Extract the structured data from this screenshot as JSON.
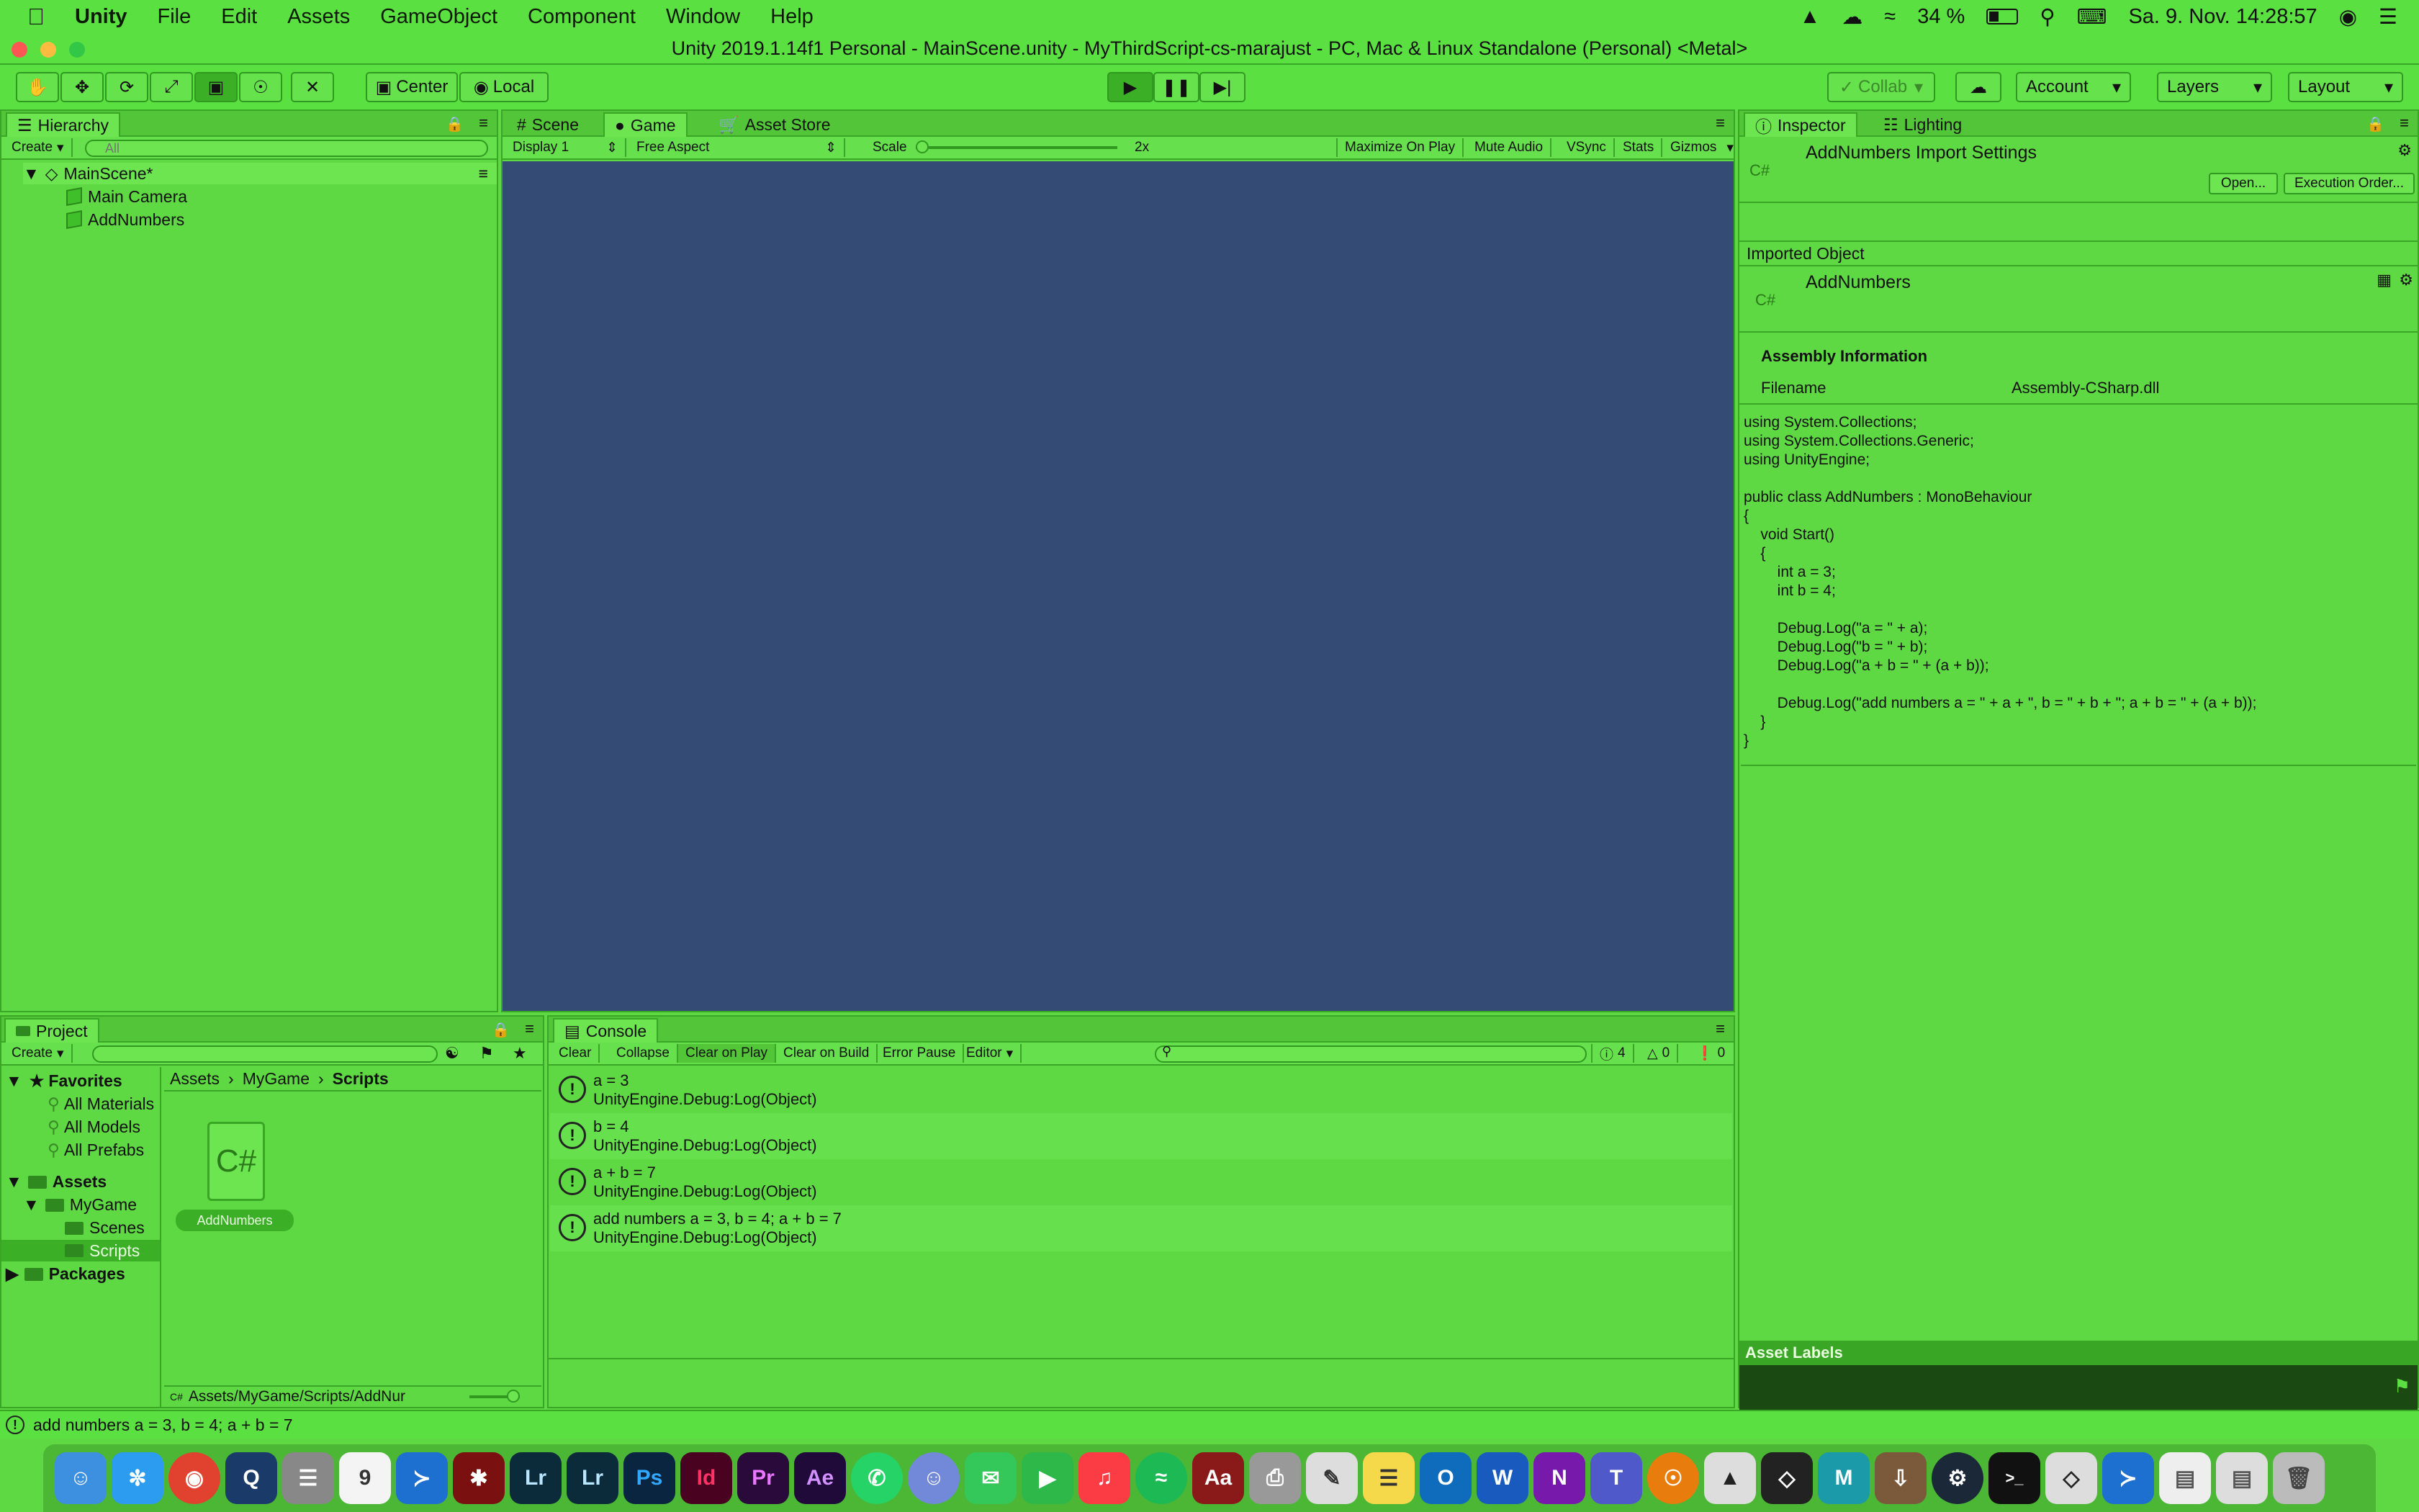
{
  "menubar": {
    "app": "Unity",
    "items": [
      "File",
      "Edit",
      "Assets",
      "GameObject",
      "Component",
      "Window",
      "Help"
    ],
    "battery": "34 %",
    "datetime": "Sa. 9. Nov.  14:28:57"
  },
  "titlebar": {
    "title": "Unity 2019.1.14f1 Personal - MainScene.unity - MyThirdScript-cs-marajust - PC, Mac & Linux Standalone (Personal) <Metal>"
  },
  "toolbar": {
    "center": "Center",
    "local": "Local",
    "collab": "Collab",
    "account": "Account",
    "layers": "Layers",
    "layout": "Layout"
  },
  "hierarchy": {
    "tab": "Hierarchy",
    "create": "Create",
    "search_placeholder": "All",
    "scene": "MainScene*",
    "items": [
      "Main Camera",
      "AddNumbers"
    ]
  },
  "scene_tabs": {
    "scene": "Scene",
    "game": "Game",
    "asset_store": "Asset Store"
  },
  "game_bar": {
    "display": "Display 1",
    "aspect": "Free Aspect",
    "scale": "Scale",
    "scale_value": "2x",
    "maximize": "Maximize On Play",
    "mute": "Mute Audio",
    "vsync": "VSync",
    "stats": "Stats",
    "gizmos": "Gizmos"
  },
  "inspector": {
    "tab": "Inspector",
    "lighting": "Lighting",
    "header": "AddNumbers Import Settings",
    "open": "Open...",
    "execution_order": "Execution Order...",
    "imported_object": "Imported Object",
    "object_name": "AddNumbers",
    "assembly_info": "Assembly Information",
    "filename_label": "Filename",
    "filename_value": "Assembly-CSharp.dll",
    "code": "using System.Collections;\nusing System.Collections.Generic;\nusing UnityEngine;\n\npublic class AddNumbers : MonoBehaviour\n{\n    void Start()\n    {\n        int a = 3;\n        int b = 4;\n\n        Debug.Log(\"a = \" + a);\n        Debug.Log(\"b = \" + b);\n        Debug.Log(\"a + b = \" + (a + b));\n\n        Debug.Log(\"add numbers a = \" + a + \", b = \" + b + \"; a + b = \" + (a + b));\n    }\n}",
    "asset_labels": "Asset Labels"
  },
  "project": {
    "tab": "Project",
    "create": "Create",
    "favorites": "Favorites",
    "fav_items": [
      "All Materials",
      "All Models",
      "All Prefabs"
    ],
    "assets": "Assets",
    "mygame": "MyGame",
    "scenes": "Scenes",
    "scripts": "Scripts",
    "packages": "Packages",
    "breadcrumb": [
      "Assets",
      "MyGame",
      "Scripts"
    ],
    "file_icon": "C#",
    "file_name": "AddNumbers",
    "path": "Assets/MyGame/Scripts/AddNur"
  },
  "console": {
    "tab": "Console",
    "buttons": [
      "Clear",
      "Collapse",
      "Clear on Play",
      "Clear on Build",
      "Error Pause",
      "Editor"
    ],
    "counts": {
      "info": "4",
      "warn": "0",
      "error": "0"
    },
    "logs": [
      {
        "msg": "a = 3",
        "trace": "UnityEngine.Debug:Log(Object)"
      },
      {
        "msg": "b = 4",
        "trace": "UnityEngine.Debug:Log(Object)"
      },
      {
        "msg": "a + b = 7",
        "trace": "UnityEngine.Debug:Log(Object)"
      },
      {
        "msg": "add numbers a = 3, b = 4; a + b = 7",
        "trace": "UnityEngine.Debug:Log(Object)"
      }
    ]
  },
  "statusbar": {
    "text": "add numbers a = 3, b = 4; a + b = 7"
  },
  "dock": {
    "labels": [
      "Lr",
      "Lr",
      "Ps",
      "Id",
      "Pr",
      "Ae",
      "Aa",
      "W",
      "N",
      "T"
    ]
  }
}
